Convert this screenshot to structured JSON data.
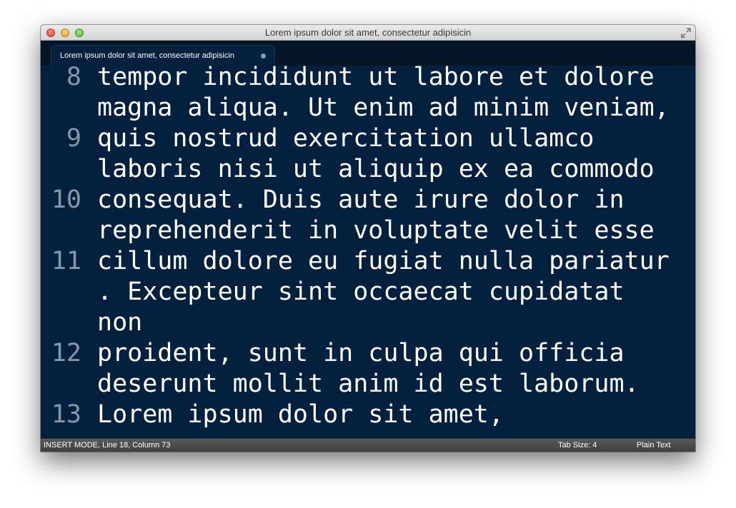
{
  "window": {
    "title": "Lorem ipsum dolor sit amet, consectetur adipisicin"
  },
  "tab": {
    "label": "Lorem ipsum dolor sit amet, consectetur adipisicin"
  },
  "editor": {
    "lines": [
      {
        "number": "8",
        "text": "tempor incididunt ut labore et dolore"
      },
      {
        "number": "",
        "text": "magna aliqua. Ut enim ad minim veniam,"
      },
      {
        "number": "9",
        "text": "quis nostrud exercitation ullamco"
      },
      {
        "number": "",
        "text": "laboris nisi ut aliquip ex ea commodo"
      },
      {
        "number": "10",
        "text": "consequat. Duis aute irure dolor in"
      },
      {
        "number": "",
        "text": "reprehenderit in voluptate velit esse"
      },
      {
        "number": "11",
        "text": "cillum dolore eu fugiat nulla pariatur"
      },
      {
        "number": "",
        "text": ". Excepteur sint occaecat cupidatat"
      },
      {
        "number": "",
        "text": "non"
      },
      {
        "number": "12",
        "text": "proident, sunt in culpa qui officia"
      },
      {
        "number": "",
        "text": "deserunt mollit anim id est laborum."
      },
      {
        "number": "13",
        "text": "Lorem ipsum dolor sit amet,"
      }
    ]
  },
  "status": {
    "mode": "INSERT MODE, Line 18, Column 73",
    "tab_size": "Tab Size: 4",
    "syntax": "Plain Text"
  },
  "colors": {
    "editor_background": "#04203f",
    "text": "#ffffff",
    "gutter_text": "#8797a8"
  }
}
